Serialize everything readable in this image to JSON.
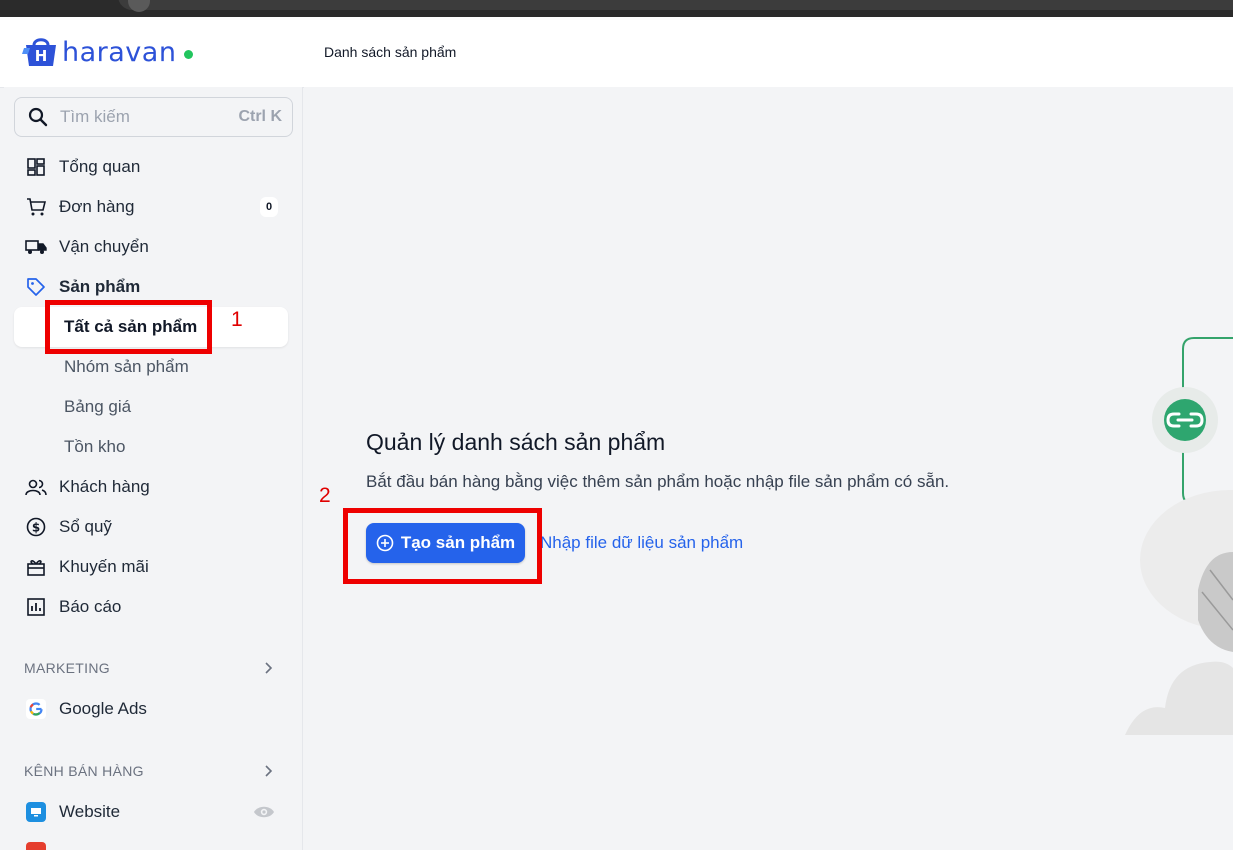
{
  "header": {
    "logo_text": "haravan",
    "page_title": "Danh sách sản phẩm"
  },
  "search": {
    "placeholder": "Tìm kiếm",
    "shortcut": "Ctrl K"
  },
  "sidebar": {
    "items": [
      {
        "label": "Tổng quan",
        "icon": "dashboard-icon"
      },
      {
        "label": "Đơn hàng",
        "icon": "cart-icon",
        "badge": "0"
      },
      {
        "label": "Vận chuyển",
        "icon": "truck-icon"
      },
      {
        "label": "Sản phẩm",
        "icon": "tag-icon"
      },
      {
        "label": "Khách hàng",
        "icon": "users-icon"
      },
      {
        "label": "Sổ quỹ",
        "icon": "dollar-circle-icon"
      },
      {
        "label": "Khuyến mãi",
        "icon": "gift-icon"
      },
      {
        "label": "Báo cáo",
        "icon": "report-icon"
      }
    ],
    "product_subitems": [
      {
        "label": "Tất cả sản phẩm",
        "active": true
      },
      {
        "label": "Nhóm sản phẩm"
      },
      {
        "label": "Bảng giá"
      },
      {
        "label": "Tồn kho"
      }
    ],
    "marketing_heading": "MARKETING",
    "marketing_items": [
      {
        "label": "Google Ads",
        "icon": "google-icon"
      }
    ],
    "channels_heading": "KÊNH BÁN HÀNG",
    "channel_items": [
      {
        "label": "Website",
        "icon": "website-icon"
      },
      {
        "label": "",
        "icon": "sales-channel-icon"
      }
    ]
  },
  "main": {
    "title": "Quản lý danh sách sản phẩm",
    "description": "Bắt đầu bán hàng bằng việc thêm sản phẩm hoặc nhập file sản phẩm có sẵn.",
    "create_button": "Tạo sản phẩm",
    "import_link": "Nhập file dữ liệu sản phẩm"
  },
  "annotations": {
    "step1": "1",
    "step2": "2",
    "color": "#ee0000"
  },
  "colors": {
    "brand": "#2d52d8",
    "primary_button": "#2563eb",
    "online_dot": "#22c55e"
  }
}
